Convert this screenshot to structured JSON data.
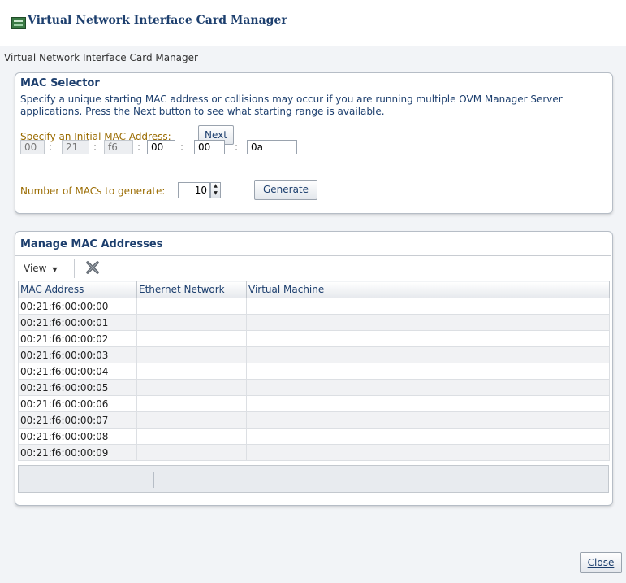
{
  "window": {
    "title": "Virtual Network Interface Card Manager",
    "subtitle": "Virtual Network Interface Card Manager"
  },
  "mac_selector": {
    "title": "MAC Selector",
    "description": "Specify a unique starting MAC address or collisions may occur if you are running multiple OVM Manager Server applications. Press the Next button to see what starting range is available.",
    "initial_label": "Specify an Initial MAC Address:",
    "next_label": "Next",
    "octets": [
      "00",
      "21",
      "f6",
      "00",
      "00",
      "0a"
    ],
    "separator": ":",
    "count_label": "Number of MACs to generate:",
    "count_value": "10",
    "generate_label": "Generate"
  },
  "manage": {
    "title": "Manage MAC Addresses",
    "view_label": "View",
    "columns": [
      "MAC Address",
      "Ethernet Network",
      "Virtual Machine"
    ],
    "rows": [
      "00:21:f6:00:00:00",
      "00:21:f6:00:00:01",
      "00:21:f6:00:00:02",
      "00:21:f6:00:00:03",
      "00:21:f6:00:00:04",
      "00:21:f6:00:00:05",
      "00:21:f6:00:00:06",
      "00:21:f6:00:00:07",
      "00:21:f6:00:00:08",
      "00:21:f6:00:00:09"
    ]
  },
  "footer": {
    "close_label": "Close"
  },
  "icons": {
    "window_icon": "network-card-icon",
    "view_dropdown": "chevron-down-icon",
    "delete": "delete-x-icon",
    "spinner_up": "spin-up-icon",
    "spinner_down": "spin-down-icon"
  },
  "colors": {
    "title_text": "#1d3f6e",
    "label_gold": "#9a6b00",
    "panel_border": "#b6bdc6"
  }
}
